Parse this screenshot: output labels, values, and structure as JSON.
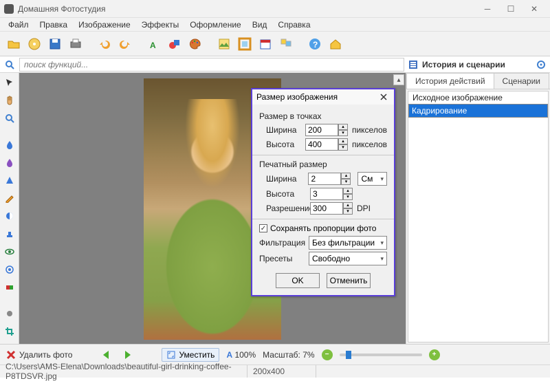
{
  "app": {
    "title": "Домашняя Фотостудия"
  },
  "menus": [
    "Файл",
    "Правка",
    "Изображение",
    "Эффекты",
    "Оформление",
    "Вид",
    "Справка"
  ],
  "toolbar_icons": [
    "folder-open",
    "cd",
    "save",
    "print",
    "undo",
    "redo",
    "text-A",
    "palette",
    "image-effect",
    "frame",
    "calendar",
    "collage",
    "help",
    "home"
  ],
  "search": {
    "placeholder": "поиск функций..."
  },
  "side_panel": {
    "title": "История и сценарии"
  },
  "tabs": {
    "history": "История действий",
    "scenarios": "Сценарии"
  },
  "history": {
    "items": [
      "Исходное изображение",
      "Кадрирование"
    ],
    "selected": 1
  },
  "left_tools": [
    "pointer",
    "hand",
    "zoom",
    "drop-blue",
    "drop-purple",
    "shape",
    "pencil",
    "contrast",
    "stamp",
    "eye",
    "target",
    "red-green",
    "brush",
    "crop"
  ],
  "dialog": {
    "title": "Размер изображения",
    "group_pixels": "Размер в точках",
    "group_print": "Печатный размер",
    "width_label": "Ширина",
    "height_label": "Высота",
    "resolution_label": "Разрешение",
    "px_unit": "пикселов",
    "dpi_unit": "DPI",
    "cm_unit": "См",
    "px_width": "200",
    "px_height": "400",
    "print_width": "2",
    "print_height": "3",
    "resolution": "300",
    "keep_aspect": "Сохранять пропорции фото",
    "filter_label": "Фильтрация",
    "filter_value": "Без фильтрации",
    "preset_label": "Пресеты",
    "preset_value": "Свободно",
    "ok": "OK",
    "cancel": "Отменить"
  },
  "bottom": {
    "delete": "Удалить фото",
    "fit": "Уместить",
    "zoom100": "100%",
    "scale_label": "Масштаб:",
    "scale_value": "7%"
  },
  "status": {
    "path": "C:\\Users\\AMS-Elena\\Downloads\\beautiful-girl-drinking-coffee-P8TDSVR.jpg",
    "dims": "200x400"
  },
  "colors": {
    "accent": "#5a3fd8",
    "selection": "#1a72d8"
  }
}
